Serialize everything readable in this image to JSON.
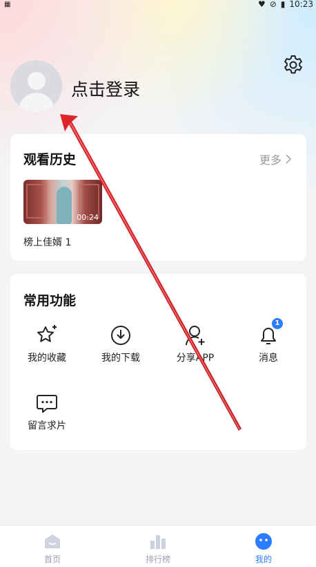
{
  "status_bar": {
    "time": "10:23"
  },
  "profile": {
    "login_text": "点击登录"
  },
  "history": {
    "title": "观看历史",
    "more_label": "更多",
    "items": [
      {
        "title": "榜上佳婿 1",
        "duration": "00:24"
      }
    ]
  },
  "functions": {
    "title": "常用功能",
    "items": [
      {
        "label": "我的收藏",
        "icon": "star-icon"
      },
      {
        "label": "我的下载",
        "icon": "download-icon"
      },
      {
        "label": "分享APP",
        "icon": "share-user-icon"
      },
      {
        "label": "消息",
        "icon": "bell-icon",
        "badge": "1"
      },
      {
        "label": "留言求片",
        "icon": "chat-icon"
      }
    ]
  },
  "tabbar": {
    "items": [
      {
        "label": "首页",
        "icon": "home-icon"
      },
      {
        "label": "排行榜",
        "icon": "ranking-icon"
      },
      {
        "label": "我的",
        "icon": "profile-face-icon",
        "active": true
      }
    ]
  },
  "colors": {
    "accent": "#2b7cff",
    "annotation_arrow": "#e0242a"
  }
}
